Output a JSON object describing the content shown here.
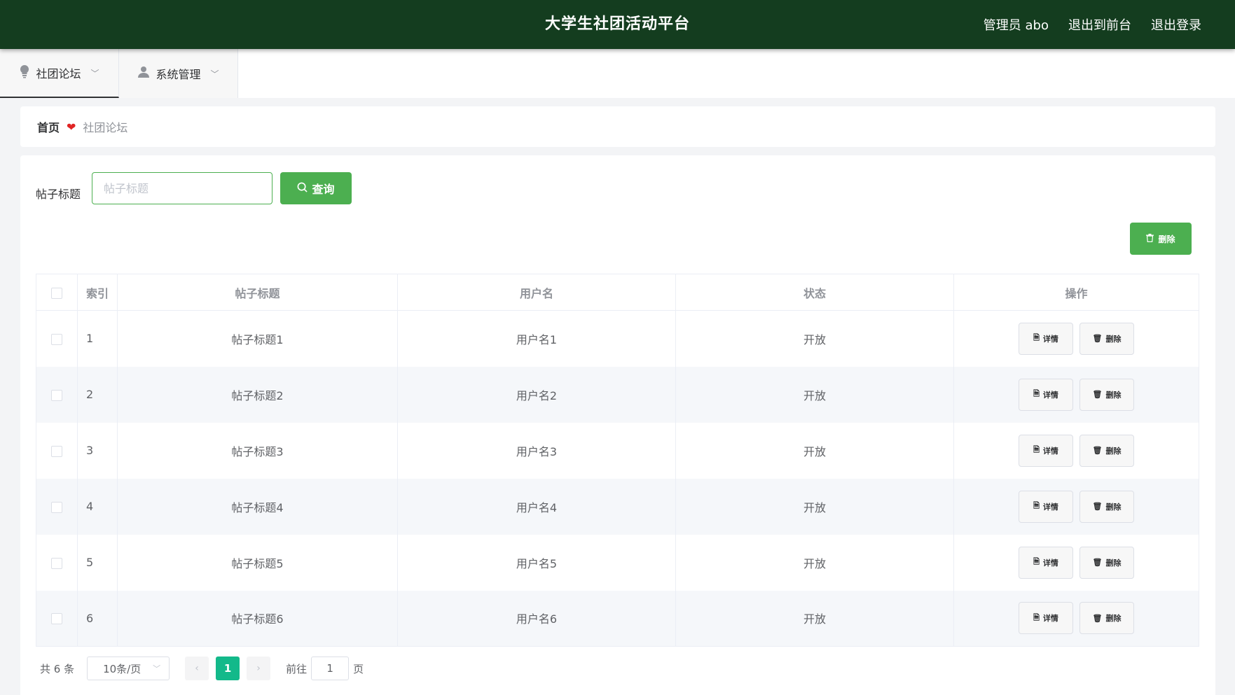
{
  "header": {
    "title": "大学生社团活动平台",
    "user_label": "管理员 abo",
    "front_label": "退出到前台",
    "logout_label": "退出登录"
  },
  "nav": {
    "items": [
      {
        "label": "社团论坛",
        "icon": "lightbulb-icon"
      },
      {
        "label": "系统管理",
        "icon": "user-icon"
      }
    ]
  },
  "breadcrumb": {
    "home": "首页",
    "current": "社团论坛"
  },
  "search": {
    "label": "帖子标题",
    "placeholder": "帖子标题",
    "value": "",
    "query_label": "查询"
  },
  "toolbar": {
    "delete_label": "删除"
  },
  "table": {
    "columns": [
      "索引",
      "帖子标题",
      "用户名",
      "状态",
      "操作"
    ],
    "detail_label": "详情",
    "delete_label": "删除",
    "rows": [
      {
        "index": "1",
        "title": "帖子标题1",
        "username": "用户名1",
        "status": "开放"
      },
      {
        "index": "2",
        "title": "帖子标题2",
        "username": "用户名2",
        "status": "开放"
      },
      {
        "index": "3",
        "title": "帖子标题3",
        "username": "用户名3",
        "status": "开放"
      },
      {
        "index": "4",
        "title": "帖子标题4",
        "username": "用户名4",
        "status": "开放"
      },
      {
        "index": "5",
        "title": "帖子标题5",
        "username": "用户名5",
        "status": "开放"
      },
      {
        "index": "6",
        "title": "帖子标题6",
        "username": "用户名6",
        "status": "开放"
      }
    ]
  },
  "pagination": {
    "total_text": "共 6 条",
    "page_size": "10条/页",
    "current_page": "1",
    "goto_prefix": "前往",
    "goto_value": "1",
    "goto_suffix": "页"
  },
  "colors": {
    "header_bg": "#143d1f",
    "primary": "#4caf50",
    "page_active": "#13b98a",
    "heart": "#e02424"
  }
}
